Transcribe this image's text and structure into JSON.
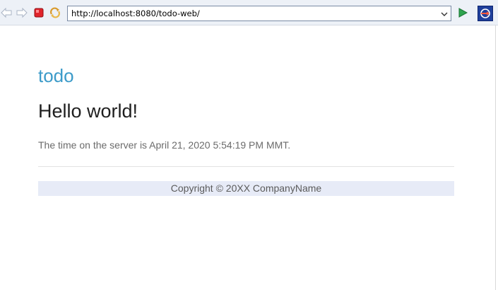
{
  "browser": {
    "address": "http://localhost:8080/todo-web/",
    "icons": {
      "back": "back-arrow-icon",
      "forward": "forward-arrow-icon",
      "stop": "stop-icon",
      "refresh": "refresh-icon",
      "dropdown": "chevron-down-icon",
      "go": "go-play-icon",
      "open": "open-external-icon"
    }
  },
  "page": {
    "brand": "todo",
    "headline": "Hello world!",
    "server_time": "The time on the server is April 21, 2020 5:54:19 PM MMT.",
    "footer": "Copyright © 20XX CompanyName"
  },
  "colors": {
    "brand": "#3c9bc9",
    "footer_bg": "#e7ebf7",
    "stop": "#e0242b",
    "go": "#2ea44f"
  }
}
